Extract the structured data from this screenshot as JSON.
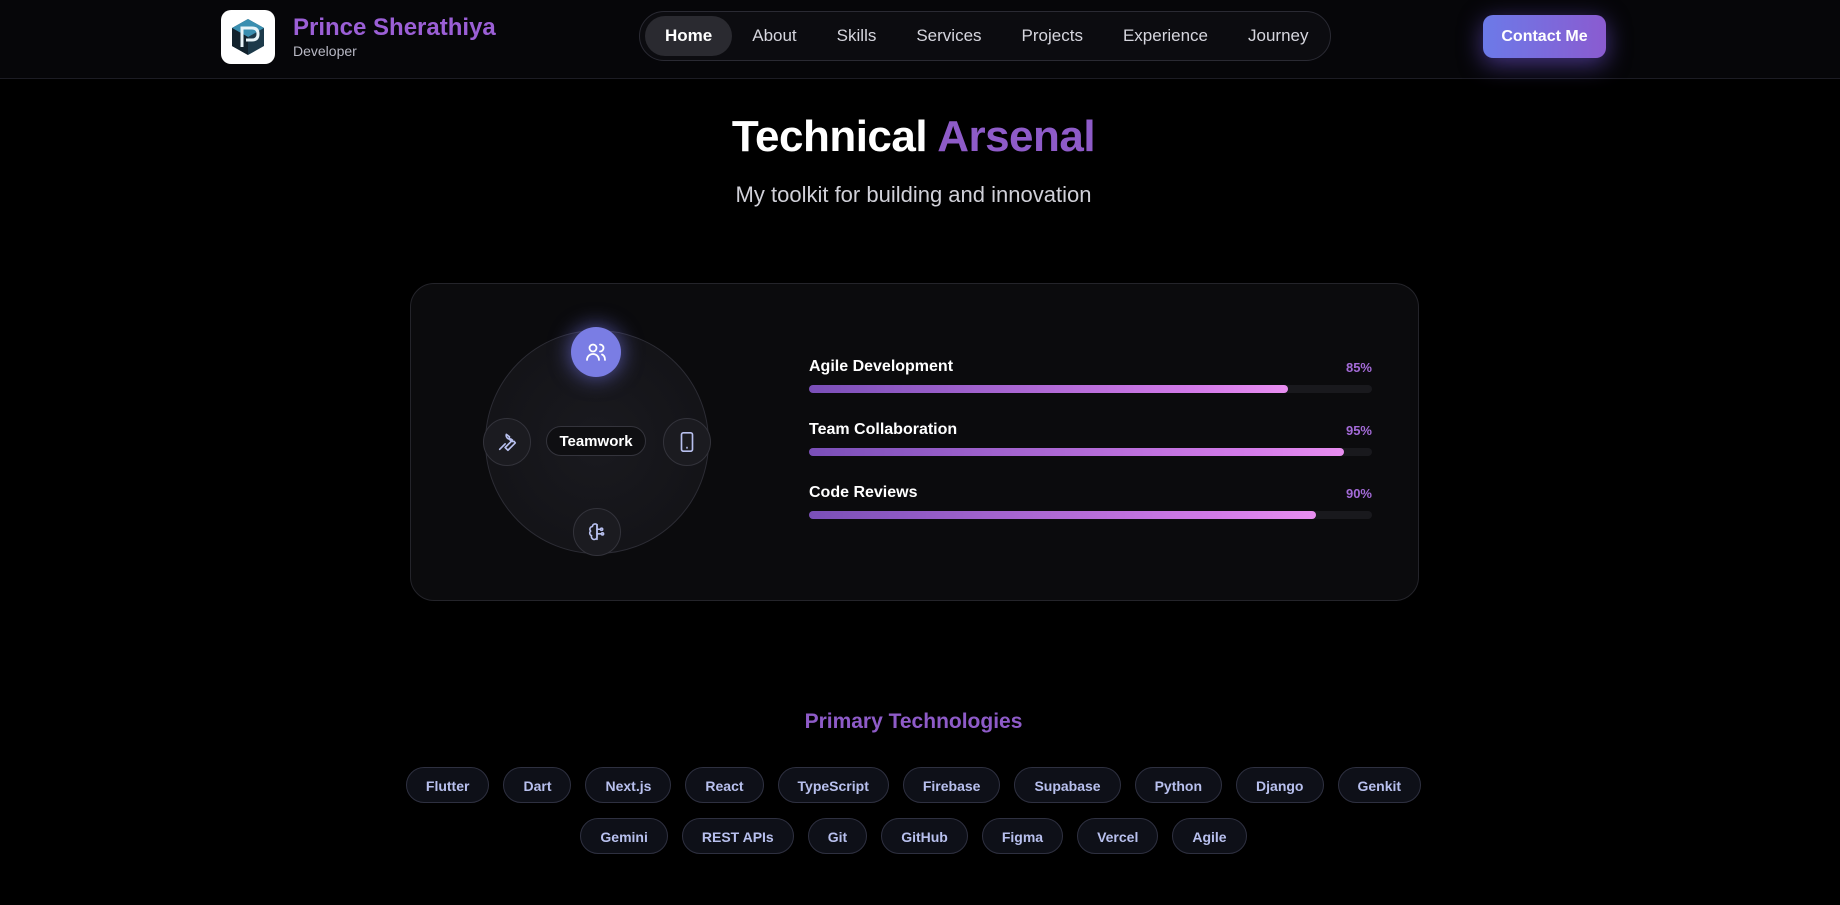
{
  "header": {
    "brand_name": "Prince Sherathiya",
    "brand_role": "Developer",
    "nav": [
      "Home",
      "About",
      "Skills",
      "Services",
      "Projects",
      "Experience",
      "Journey"
    ],
    "active_nav": "Home",
    "contact_label": "Contact Me"
  },
  "hero": {
    "title_main": "Technical",
    "title_accent": "Arsenal",
    "subtitle": "My toolkit for building and innovation"
  },
  "skills_card": {
    "center_label": "Teamwork",
    "orbit_icons": [
      "users-icon",
      "wrench-icon",
      "tablet-icon",
      "brain-icon"
    ],
    "skills": [
      {
        "name": "Agile Development",
        "percent": "85%",
        "value": 85
      },
      {
        "name": "Team Collaboration",
        "percent": "95%",
        "value": 95
      },
      {
        "name": "Code Reviews",
        "percent": "90%",
        "value": 90
      }
    ]
  },
  "technologies": {
    "heading": "Primary Technologies",
    "row1": [
      "Flutter",
      "Dart",
      "Next.js",
      "React",
      "TypeScript",
      "Firebase",
      "Supabase",
      "Python",
      "Django",
      "Genkit"
    ],
    "row2": [
      "Gemini",
      "REST APIs",
      "Git",
      "GitHub",
      "Figma",
      "Vercel",
      "Agile"
    ]
  },
  "colors": {
    "accent_purple": "#8e5bc8",
    "button_gradient_start": "#6c7ae8",
    "button_gradient_end": "#8a5bd0",
    "bar_fill_end": "#e88ef0"
  }
}
